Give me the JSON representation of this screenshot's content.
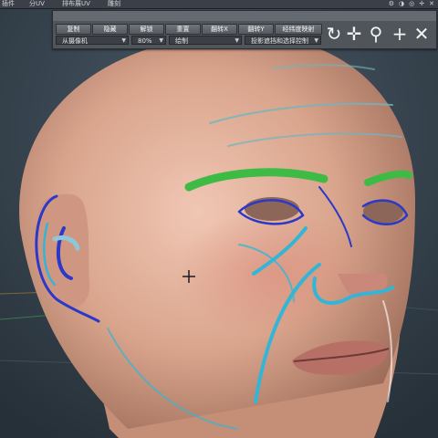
{
  "menubar": {
    "items": [
      "插件",
      "分UV",
      "排布展UV",
      "雕刻"
    ]
  },
  "toolbar": {
    "buttons": [
      "复制",
      "隐藏",
      "解锁",
      "重置",
      "翻转X",
      "翻转Y",
      "经纬度映射"
    ],
    "dropdowns": [
      {
        "value": "从摄像机"
      },
      {
        "value": "80%"
      },
      {
        "value": "绘制"
      },
      {
        "value": "投影遮挡和选择控制"
      }
    ]
  },
  "colors": {
    "eyebrow": "#3dbb45",
    "cyan_stroke": "#33b6d6",
    "blue_stroke": "#2b38c8",
    "skin": "#d9a88f",
    "background": "#2f3a44"
  }
}
